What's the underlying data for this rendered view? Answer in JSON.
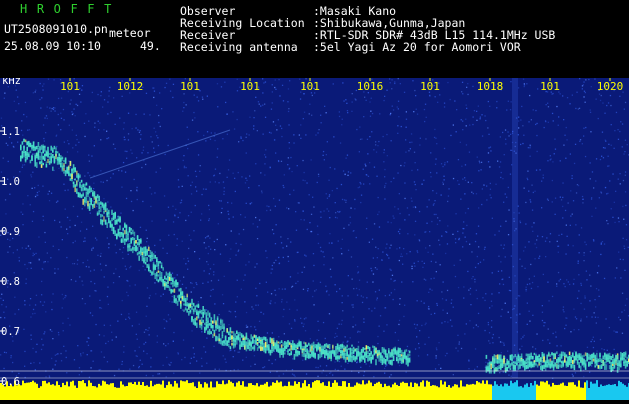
{
  "header": {
    "title": "HROFFT",
    "filename": "UT2508091010.pn",
    "tag": "meteor",
    "datetime": "25.08.09 10:10",
    "seconds": "49.",
    "fields": [
      {
        "label": "Observer",
        "value": ":Masaki Kano"
      },
      {
        "label": "Receiving Location",
        "value": ":Shibukawa,Gunma,Japan"
      },
      {
        "label": "Receiver",
        "value": ":RTL-SDR SDR# 43dB L15 114.1MHz USB"
      },
      {
        "label": "Receiving antenna",
        "value": ":5el Yagi Az 20 for Aomori VOR"
      }
    ]
  },
  "spectrogram": {
    "y_unit": "kHz",
    "y_ticks": [
      "1.1",
      "1.0",
      "0.9",
      "0.8",
      "0.7",
      "0.6"
    ],
    "x_ticks": [
      "101",
      "1012",
      "101",
      "101",
      "101",
      "1016",
      "101",
      "1018",
      "101",
      "1020"
    ],
    "colors": {
      "background": "#0a1a78",
      "noise": "#2f58e0",
      "signal": "#49e0c8",
      "hot": "#f0f06a",
      "tick_label": "#ffff00",
      "axis_label": "#ffffff",
      "band": "#ffff00",
      "band_right": "#19c8f0"
    }
  }
}
